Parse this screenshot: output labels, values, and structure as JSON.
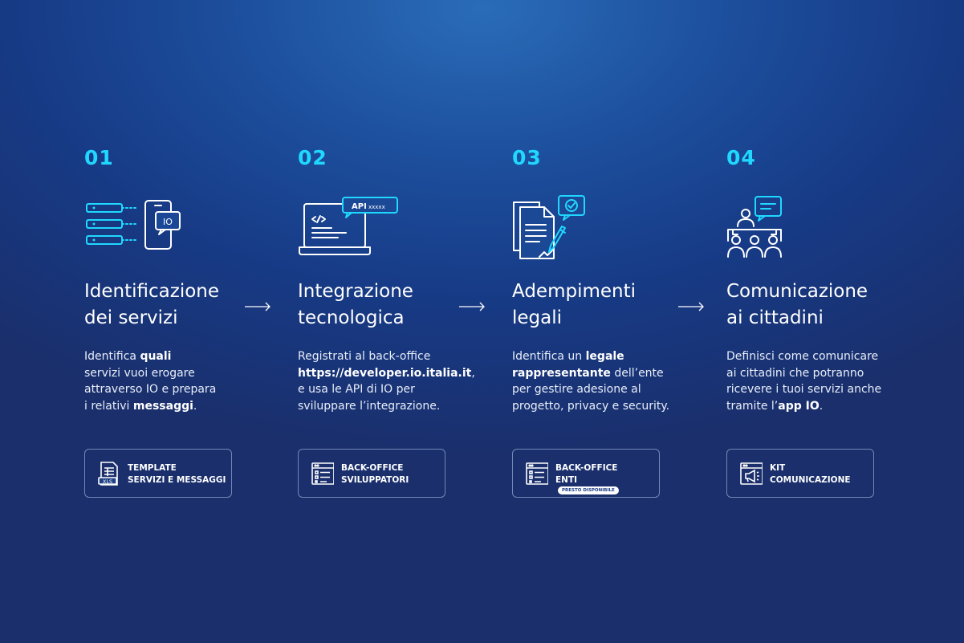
{
  "steps": [
    {
      "number": "01",
      "icon": "service-identification-icon",
      "title": [
        "Identificazione",
        "dei servizi"
      ],
      "desc": [
        [
          {
            "t": "Identifica "
          },
          {
            "t": "quali",
            "b": true
          }
        ],
        [
          {
            "t": "servizi vuoi erogare"
          }
        ],
        [
          {
            "t": "attraverso IO e prepara"
          }
        ],
        [
          {
            "t": "i relativi "
          },
          {
            "t": "messaggi",
            "b": true
          },
          {
            "t": "."
          }
        ]
      ],
      "button": {
        "line1": "TEMPLATE",
        "line2": "SERVIZI E MESSAGGI",
        "icon": "xls-file-icon"
      }
    },
    {
      "number": "02",
      "icon": "laptop-api-icon",
      "title": [
        "Integrazione",
        "tecnologica"
      ],
      "desc": [
        [
          {
            "t": "Registrati al back-office"
          }
        ],
        [
          {
            "t": "https://developer.io.italia.it",
            "b": true
          },
          {
            "t": ","
          }
        ],
        [
          {
            "t": "e usa le API di IO per"
          }
        ],
        [
          {
            "t": "sviluppare l’integrazione."
          }
        ]
      ],
      "button": {
        "line1": "BACK-OFFICE",
        "line2": "SVILUPPATORI",
        "icon": "backoffice-window-icon"
      }
    },
    {
      "number": "03",
      "icon": "legal-document-sign-icon",
      "title": [
        "Adempimenti",
        "legali"
      ],
      "desc": [
        [
          {
            "t": "Identifica un "
          },
          {
            "t": "legale",
            "b": true
          }
        ],
        [
          {
            "t": "rappresentante",
            "b": true
          },
          {
            "t": " dell’ente"
          }
        ],
        [
          {
            "t": "per gestire adesione al"
          }
        ],
        [
          {
            "t": "progetto, privacy e security."
          }
        ]
      ],
      "button": {
        "line1": "BACK-OFFICE",
        "line2": "ENTI",
        "badge": "PRESTO DISPONIBILE",
        "icon": "backoffice-window-icon"
      }
    },
    {
      "number": "04",
      "icon": "citizens-communication-icon",
      "title": [
        "Comunicazione",
        "ai cittadini"
      ],
      "desc": [
        [
          {
            "t": "Definisci come comunicare"
          }
        ],
        [
          {
            "t": "ai cittadini che potranno"
          }
        ],
        [
          {
            "t": "ricevere i tuoi servizi anche"
          }
        ],
        [
          {
            "t": "tramite l’"
          },
          {
            "t": "app IO",
            "b": true
          },
          {
            "t": "."
          }
        ]
      ],
      "button": {
        "line1": "KIT",
        "line2": "COMUNICAZIONE",
        "icon": "megaphone-window-icon"
      }
    }
  ],
  "icon_labels": {
    "io": "IO",
    "api": "API",
    "api_key": "xxxxx",
    "xls": "XLS"
  },
  "arrow_icon": "arrow-right-icon",
  "colors": {
    "accent": "#20d8ff",
    "text": "#ffffff",
    "badge_text": "#1b3d86"
  }
}
